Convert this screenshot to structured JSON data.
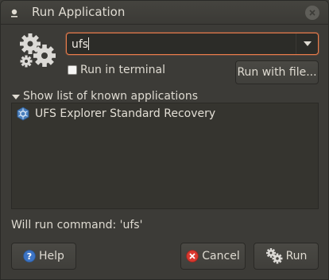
{
  "window": {
    "title": "Run Application",
    "accent_color": "#ea7c4b"
  },
  "command": {
    "value": "ufs"
  },
  "options": {
    "run_in_terminal_label": "Run in terminal",
    "run_in_terminal_checked": false,
    "run_with_file_label": "Run with file..."
  },
  "known_apps": {
    "expander_label": "Show list of known applications",
    "items": [
      {
        "label": "UFS Explorer Standard Recovery",
        "icon": "ufs-explorer-icon"
      }
    ]
  },
  "status": {
    "text": "Will run command: 'ufs'"
  },
  "buttons": {
    "help_label": "Help",
    "cancel_label": "Cancel",
    "run_label": "Run"
  }
}
